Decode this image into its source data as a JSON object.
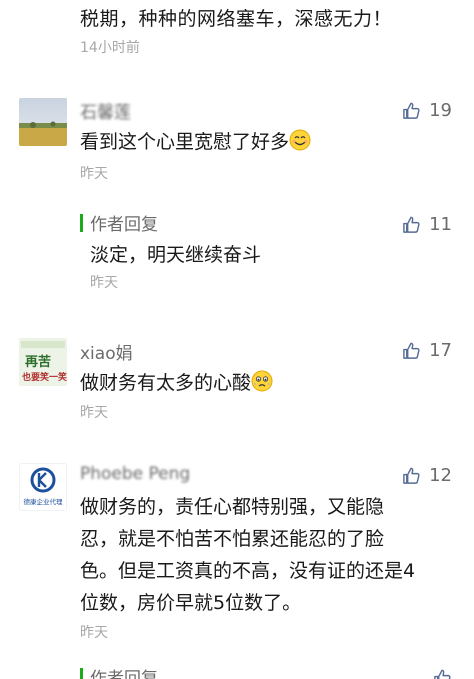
{
  "top": {
    "text": "税期，种种的网络塞车，深感无力！",
    "time": "14小时前"
  },
  "comments": [
    {
      "name": "石馨莲",
      "text": "看到这个心里宽慰了好多",
      "emoji": "smile-emoji",
      "time": "昨天",
      "likes": "19",
      "reply": {
        "label": "作者回复",
        "text": "淡定，明天继续奋斗",
        "time": "昨天",
        "likes": "11"
      }
    },
    {
      "name": "xiao娟",
      "avatar_text": [
        "再苦",
        "也要笑一笑"
      ],
      "text": "做财务有太多的心酸",
      "emoji": "sad-emoji",
      "time": "昨天",
      "likes": "17"
    },
    {
      "name": "Phoebe Peng",
      "avatar_text": [
        "德康企业代理"
      ],
      "lines": [
        "做财务的，责任心都特别强，又能隐",
        "忍，就是不怕苦不怕累还能忍的了脸",
        "色。但是工资真的不高，没有证的还是4",
        "位数，房价早就5位数了。"
      ],
      "time": "昨天",
      "likes": "12"
    }
  ],
  "bottom_reply": {
    "label": "作者回复"
  },
  "icons": {
    "like": "thumbs-up-icon"
  },
  "colors": {
    "accent": "#1aad19",
    "meta": "#a8a8a8",
    "name": "#6b6b6b"
  }
}
